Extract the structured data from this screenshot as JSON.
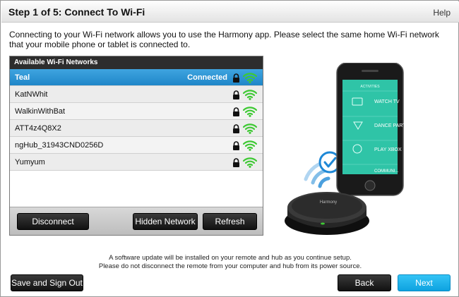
{
  "header": {
    "title": "Step 1 of 5: Connect To Wi-Fi",
    "help_label": "Help"
  },
  "intro_text": "Connecting to your Wi-Fi network allows you to use the Harmony app. Please select the same home Wi-Fi network that your mobile phone or tablet is connected to.",
  "networks_panel": {
    "header": "Available Wi-Fi Networks",
    "networks": [
      {
        "name": "Teal",
        "status": "Connected",
        "locked": true,
        "selected": true
      },
      {
        "name": "KatNWhit",
        "status": "",
        "locked": true,
        "selected": false
      },
      {
        "name": "WalkinWithBat",
        "status": "",
        "locked": true,
        "selected": false
      },
      {
        "name": "ATT4z4Q8X2",
        "status": "",
        "locked": true,
        "selected": false
      },
      {
        "name": "ngHub_31943CND0256D",
        "status": "",
        "locked": true,
        "selected": false
      },
      {
        "name": "Yumyum",
        "status": "",
        "locked": true,
        "selected": false
      }
    ],
    "disconnect_label": "Disconnect",
    "hidden_network_label": "Hidden Network",
    "refresh_label": "Refresh"
  },
  "phone_screen": {
    "brand": "ACTIVITIES",
    "items": [
      "WATCH TV",
      "DANCE PARTY",
      "PLAY XBOX",
      "COMMUNI..."
    ]
  },
  "hub_brand": "Harmony",
  "notice": {
    "line1": "A software update will be installed on your remote and hub as you continue setup.",
    "line2": "Please do not disconnect the remote from your computer and hub from its power source."
  },
  "footer": {
    "save_signout_label": "Save and Sign Out",
    "back_label": "Back",
    "next_label": "Next"
  },
  "colors": {
    "selected_row": "#1f86c8",
    "wifi_green": "#3ec934",
    "next_button": "#1aaeea",
    "phone_screen": "#2fc4a7",
    "check_badge": "#1e88d6"
  }
}
